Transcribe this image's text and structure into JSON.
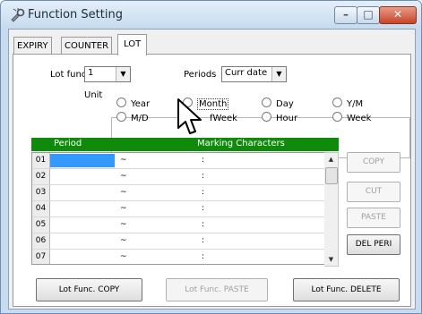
{
  "window": {
    "title": "Function Setting"
  },
  "tabs": [
    {
      "label": "EXPIRY"
    },
    {
      "label": "COUNTER"
    },
    {
      "label": "LOT",
      "active": true
    }
  ],
  "form": {
    "lot_func_label": "Lot func.",
    "lot_func_value": "1",
    "periods_label": "Periods",
    "periods_value": "Curr date",
    "unit_label": "Unit"
  },
  "unit_options": [
    {
      "label": "Year"
    },
    {
      "label": "Month",
      "selected": true
    },
    {
      "label": "Day"
    },
    {
      "label": "Y/M"
    },
    {
      "label": "M/D"
    },
    {
      "label": "Day of Week",
      "visible_text": "fWeek"
    },
    {
      "label": "Hour"
    },
    {
      "label": "Week"
    }
  ],
  "grid": {
    "headers": {
      "period": "Period",
      "marking": "Marking Characters"
    },
    "rows": [
      {
        "no": "01",
        "tilde": "~",
        "colon": ":"
      },
      {
        "no": "02",
        "tilde": "~",
        "colon": ":"
      },
      {
        "no": "03",
        "tilde": "~",
        "colon": ":"
      },
      {
        "no": "04",
        "tilde": "~",
        "colon": ":"
      },
      {
        "no": "05",
        "tilde": "~",
        "colon": ":"
      },
      {
        "no": "06",
        "tilde": "~",
        "colon": ":"
      },
      {
        "no": "07",
        "tilde": "~",
        "colon": ":"
      }
    ]
  },
  "side_buttons": {
    "copy": "COPY",
    "cut": "CUT",
    "paste": "PASTE",
    "del_peri": "DEL PERI"
  },
  "bottom_buttons": {
    "lot_copy": "Lot Func. COPY",
    "lot_paste": "Lot Func. PASTE",
    "lot_delete": "Lot Func. DELETE"
  },
  "colors": {
    "grid_header": "#0f8a0a",
    "selection": "#3399ff",
    "disabled_text": "#a0a0a0"
  },
  "icons": {
    "app": "function-wrench-icon",
    "cursor": "mouse-pointer-icon"
  }
}
